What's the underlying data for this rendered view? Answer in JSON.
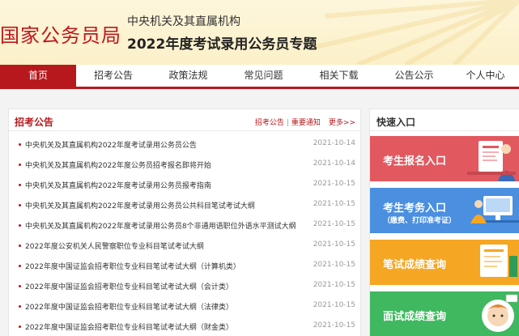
{
  "header": {
    "site_name": "国家公务员局",
    "sub_title": "中央机关及其直属机构",
    "main_title": "2022年度考试录用公务员专题"
  },
  "nav": [
    {
      "label": "首页",
      "active": true
    },
    {
      "label": "招考公告",
      "active": false
    },
    {
      "label": "政策法规",
      "active": false
    },
    {
      "label": "常见问题",
      "active": false
    },
    {
      "label": "相关下载",
      "active": false
    },
    {
      "label": "公告公示",
      "active": false
    },
    {
      "label": "个人中心",
      "active": false
    }
  ],
  "announcements": {
    "title": "招考公告",
    "link_a": "招考公告",
    "separator": "|",
    "link_b": "重要通知",
    "more": "更多>>",
    "items": [
      {
        "title": "中央机关及其直属机构2022年度考试录用公务员公告",
        "date": "2021-10-14"
      },
      {
        "title": "中央机关及其直属机构2022年度公务员招考报名即将开始",
        "date": "2021-10-14"
      },
      {
        "title": "中央机关及其直属机构2022年度考试录用公务员报考指南",
        "date": "2021-10-15"
      },
      {
        "title": "中央机关及其直属机构2022年度考试录用公务员公共科目笔试考试大纲",
        "date": "2021-10-15"
      },
      {
        "title": "中央机关及其直属机构2022年度考试录用公务员8个非通用语职位外语水平测试大纲",
        "date": "2021-10-15"
      },
      {
        "title": "2022年度公安机关人民警察职位专业科目笔试考试大纲",
        "date": "2021-10-15"
      },
      {
        "title": "2022年度中国证监会招考职位专业科目笔试考试大纲（计算机类）",
        "date": "2021-10-15"
      },
      {
        "title": "2022年度中国证监会招考职位专业科目笔试考试大纲（会计类）",
        "date": "2021-10-15"
      },
      {
        "title": "2022年度中国证监会招考职位专业科目笔试考试大纲（法律类）",
        "date": "2021-10-15"
      },
      {
        "title": "2022年度中国证监会招考职位专业科目笔试考试大纲（财金类）",
        "date": "2021-10-15"
      }
    ]
  },
  "quick": {
    "title": "快速入口",
    "cards": [
      {
        "label": "考生报名入口",
        "sub": "",
        "color": "#e2585f"
      },
      {
        "label": "考生考务入口",
        "sub": "（缴费、打印准考证）",
        "color": "#4a8fe0"
      },
      {
        "label": "笔试成绩查询",
        "sub": "",
        "color": "#f5a623"
      },
      {
        "label": "面试成绩查询",
        "sub": "",
        "color": "#3fb85f"
      }
    ]
  }
}
